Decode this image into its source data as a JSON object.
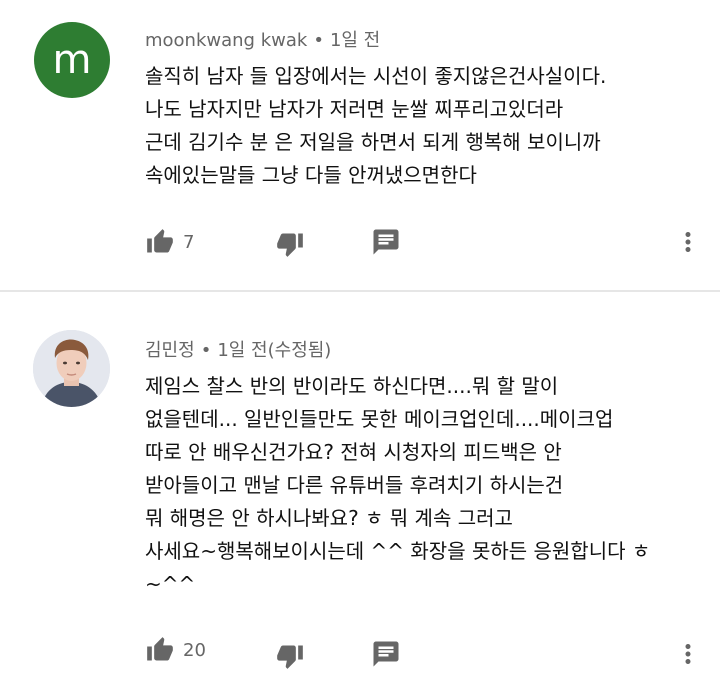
{
  "comments": [
    {
      "author": "moonkwang kwak",
      "separator": "•",
      "time": "1일 전",
      "avatar_letter": "m",
      "text": "솔직히 남자 들 입장에서는 시선이 좋지않은건사실이다.\n나도 남자지만 남자가 저러면 눈쌀 찌푸리고있더라\n근데 김기수 분 은 저일을 하면서 되게 행복해 보이니까\n속에있는말들 그냥 다들 안꺼냈으면한다",
      "likes": "7"
    },
    {
      "author": "김민정",
      "separator": "•",
      "time": "1일 전(수정됨)",
      "text": "제임스 찰스 반의 반이라도 하신다면....뭐 할 말이\n없을텐데... 일반인들만도 못한 메이크업인데....메이크업\n따로 안 배우신건가요? 전혀 시청자의 피드백은 안\n받아들이고 맨날 다른 유튜버들 후려치기 하시는건\n뭐 해명은 안 하시나봐요? ㅎ 뭐 계속 그러고\n사세요~행복해보이시는데 ^^ 화장을 못하든 응원합니다 ㅎ\n~^^",
      "likes": "20"
    }
  ],
  "icons": {
    "like": "thumb-up-icon",
    "dislike": "thumb-down-icon",
    "reply": "comment-icon",
    "more": "more-vert-icon"
  },
  "colors": {
    "avatar_green": "#2e7d32",
    "icon_gray": "#666666",
    "meta_gray": "#666666"
  }
}
